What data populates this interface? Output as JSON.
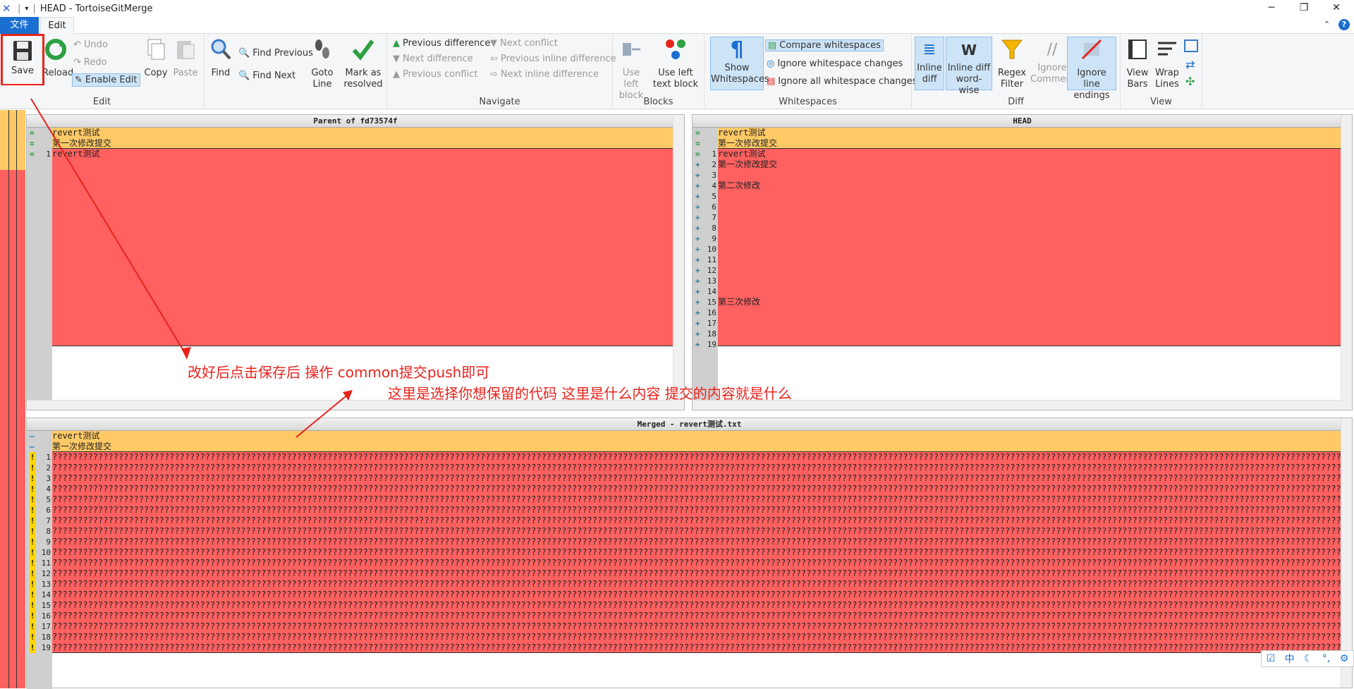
{
  "window": {
    "title": "HEAD - TortoiseGitMerge"
  },
  "tabs": {
    "file": "文件",
    "edit": "Edit"
  },
  "ribbon": {
    "save": "Save",
    "reload": "Reload",
    "undo": "Undo",
    "redo": "Redo",
    "enable_edit": "Enable Edit",
    "copy": "Copy",
    "paste": "Paste",
    "find": "Find",
    "find_previous": "Find Previous",
    "find_next": "Find Next",
    "goto_line": "Goto Line",
    "mark_resolved": "Mark as resolved",
    "edit_group": "Edit",
    "prev_diff": "Previous difference",
    "next_diff": "Next difference",
    "prev_conflict": "Previous conflict",
    "next_conflict": "Next conflict",
    "prev_inline": "Previous inline difference",
    "next_inline": "Next inline difference",
    "navigate_group": "Navigate",
    "use_left_block": "Use left block",
    "use_left_text_block": "Use left text block",
    "blocks_group": "Blocks",
    "show_whitespaces": "Show Whitespaces",
    "compare_ws": "Compare whitespaces",
    "ignore_ws_changes": "Ignore whitespace changes",
    "ignore_all_ws": "Ignore all whitespace changes",
    "whitespaces_group": "Whitespaces",
    "inline_diff": "Inline diff",
    "inline_diff_word": "Inline diff word-wise",
    "regex_filter": "Regex Filter",
    "ignore_comments": "Ignore Comments",
    "ignore_line_endings": "Ignore line endings",
    "diff_group": "Diff",
    "view_bars": "View Bars",
    "wrap_lines": "Wrap Lines",
    "view_group": "View"
  },
  "left_pane": {
    "header": "Parent of fd73574f",
    "lines": [
      {
        "mark": "=",
        "num": "",
        "text": "revert测试"
      },
      {
        "mark": "=",
        "num": "",
        "text": "第一次修改提交"
      },
      {
        "mark": "=",
        "num": "1",
        "text": "revert测试"
      }
    ]
  },
  "right_pane": {
    "header": "HEAD",
    "lines": [
      {
        "mark": "=",
        "num": "",
        "text": "revert测试"
      },
      {
        "mark": "=",
        "num": "",
        "text": "第一次修改提交"
      },
      {
        "mark": "=",
        "num": "1",
        "text": "revert测试"
      },
      {
        "mark": "+",
        "num": "2",
        "text": "第一次修改提交"
      },
      {
        "mark": "+",
        "num": "3",
        "text": ""
      },
      {
        "mark": "+",
        "num": "4",
        "text": "第二次修改"
      },
      {
        "mark": "+",
        "num": "5",
        "text": ""
      },
      {
        "mark": "+",
        "num": "6",
        "text": ""
      },
      {
        "mark": "+",
        "num": "7",
        "text": ""
      },
      {
        "mark": "+",
        "num": "8",
        "text": ""
      },
      {
        "mark": "+",
        "num": "9",
        "text": ""
      },
      {
        "mark": "+",
        "num": "10",
        "text": ""
      },
      {
        "mark": "+",
        "num": "11",
        "text": ""
      },
      {
        "mark": "+",
        "num": "12",
        "text": ""
      },
      {
        "mark": "+",
        "num": "13",
        "text": ""
      },
      {
        "mark": "+",
        "num": "14",
        "text": ""
      },
      {
        "mark": "+",
        "num": "15",
        "text": "第三次修改"
      },
      {
        "mark": "+",
        "num": "16",
        "text": ""
      },
      {
        "mark": "+",
        "num": "17",
        "text": ""
      },
      {
        "mark": "+",
        "num": "18",
        "text": ""
      },
      {
        "mark": "+",
        "num": "19",
        "text": ""
      }
    ]
  },
  "merged_pane": {
    "header": "Merged - revert测试.txt",
    "top_lines": [
      {
        "mark": "–",
        "text": "revert测试"
      },
      {
        "mark": "–",
        "text": "第一次修改提交"
      }
    ],
    "conflict_numbers": [
      "1",
      "2",
      "3",
      "4",
      "5",
      "6",
      "7",
      "8",
      "9",
      "10",
      "11",
      "12",
      "13",
      "14",
      "15",
      "16",
      "17",
      "18",
      "19"
    ],
    "conflict_text": "????????????????????????????????????????????????????????????????????????????????????????????????????????????????????????????????????????????????????????????????????????????????????????????????????????????????????????????????????????????????????????????????"
  },
  "annotations": {
    "a1": "改好后点击保存后 操作 common提交push即可",
    "a2": "这里是选择你想保留的代码 这里是什么内容 提交的内容就是什么"
  },
  "ime_bar": {
    "lang": "中",
    "moon": "☾",
    "degree": "°,",
    "gear": "⚙"
  }
}
